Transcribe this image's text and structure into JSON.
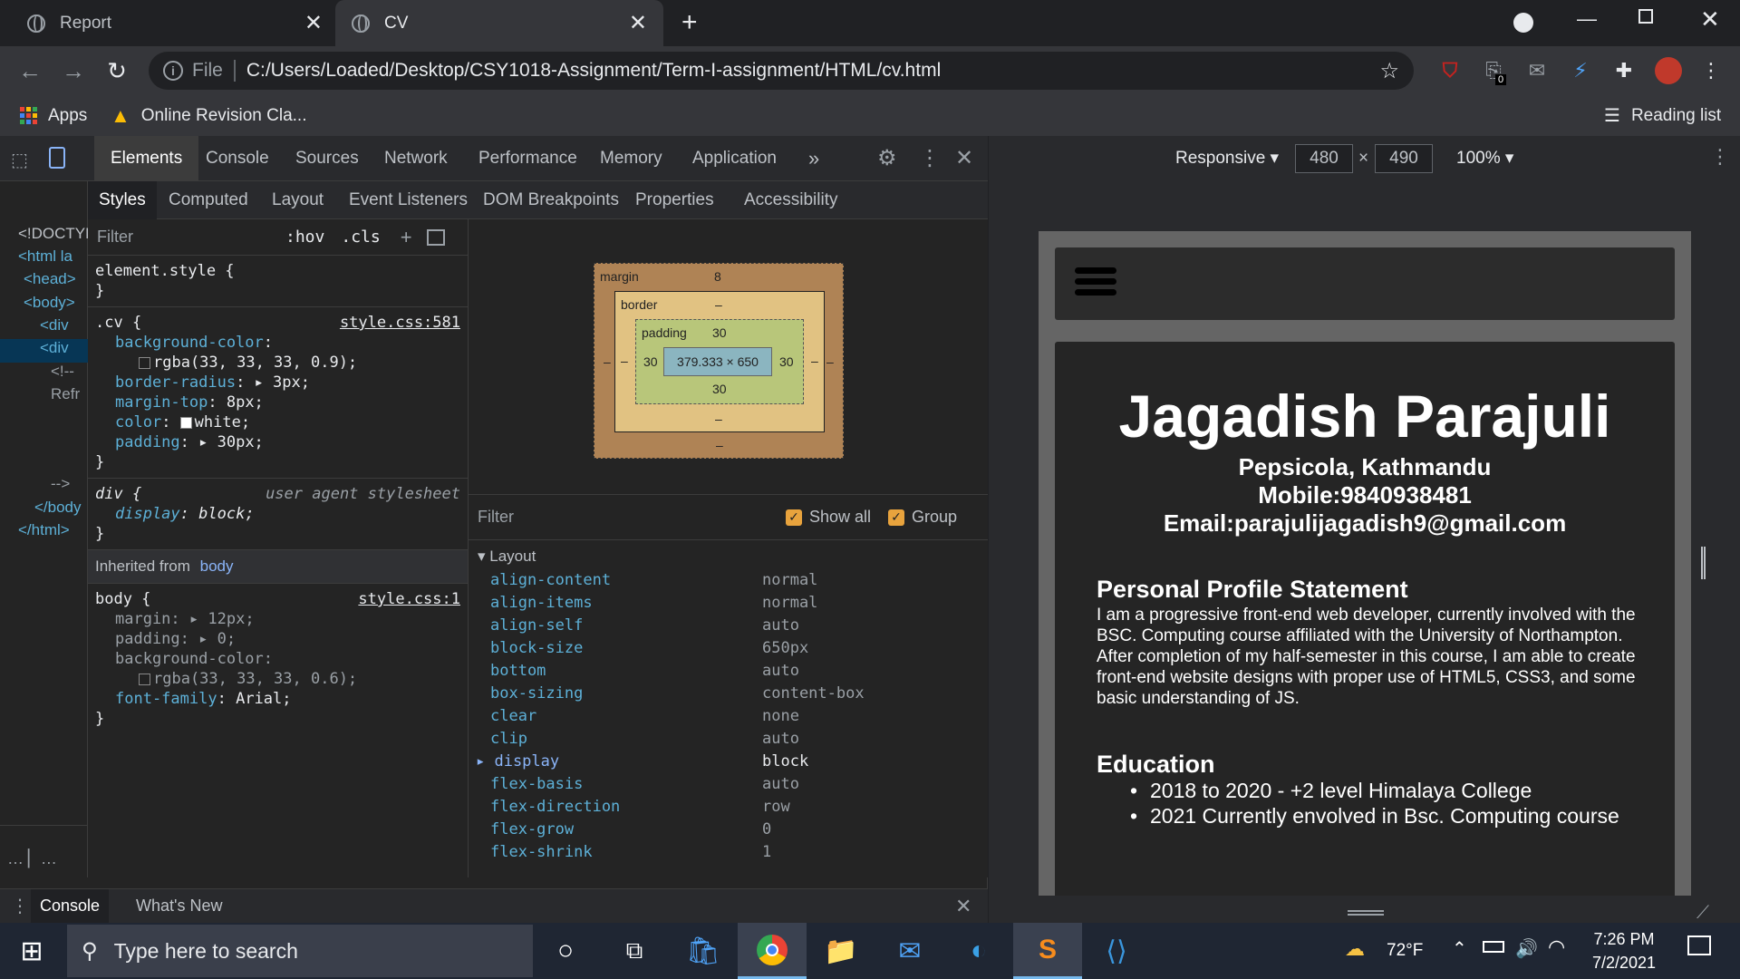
{
  "browser": {
    "tabs": [
      {
        "title": "Report",
        "close": "✕"
      },
      {
        "title": "CV",
        "close": "✕"
      }
    ],
    "new_tab": "+",
    "url_scheme": "File",
    "url": "C:/Users/Loaded/Desktop/CSY1018-Assignment/Term-I-assignment/HTML/cv.html",
    "ext_badge": "0",
    "bookmarks": {
      "apps": "Apps",
      "item": "Online Revision Cla...",
      "reading_list": "Reading list"
    }
  },
  "devtools": {
    "tabs": [
      "Elements",
      "Console",
      "Sources",
      "Network",
      "Performance",
      "Memory",
      "Application"
    ],
    "more": "»",
    "subtabs": [
      "Styles",
      "Computed",
      "Layout",
      "Event Listeners",
      "DOM Breakpoints",
      "Properties",
      "Accessibility"
    ],
    "dom": [
      "<!DOCTYP",
      "<html la",
      "<head>",
      "<body>",
      "<div",
      "<div",
      "<!--",
      "Refr",
      "-->",
      "</body",
      "</html>"
    ],
    "styles_filter": "Filter",
    "hov": ":hov",
    "cls": ".cls",
    "element_style": "element.style {",
    "cv_rule": {
      "selector": ".cv {",
      "source": "style.css:581",
      "props": [
        {
          "k": "background-color",
          "v": "rgba(33, 33, 33, 0.9);"
        },
        {
          "k": "border-radius",
          "v": "3px;"
        },
        {
          "k": "margin-top",
          "v": "8px;"
        },
        {
          "k": "color",
          "v": "white;"
        },
        {
          "k": "padding",
          "v": "30px;"
        }
      ]
    },
    "div_rule": {
      "selector": "div {",
      "source": "user agent stylesheet",
      "prop": "display",
      "val": "block;"
    },
    "inherited": {
      "label": "Inherited from",
      "from": "body"
    },
    "body_rule": {
      "selector": "body {",
      "source": "style.css:1",
      "props": [
        {
          "k": "margin",
          "v": "12px;"
        },
        {
          "k": "padding",
          "v": "0;"
        },
        {
          "k": "background-color",
          "v": "rgba(33, 33, 33, 0.6);"
        },
        {
          "k": "font-family",
          "v": "Arial;"
        }
      ]
    },
    "boxmodel": {
      "margin": "margin",
      "margin_val": "8",
      "border": "border",
      "border_val": "–",
      "padding": "padding",
      "padding_val": "30",
      "content": "379.333 × 650",
      "dash": "–"
    },
    "computed_filter": "Filter",
    "show_all": "Show all",
    "group": "Group",
    "layout_group": "Layout",
    "computed": [
      {
        "k": "align-content",
        "v": "normal"
      },
      {
        "k": "align-items",
        "v": "normal"
      },
      {
        "k": "align-self",
        "v": "auto"
      },
      {
        "k": "block-size",
        "v": "650px"
      },
      {
        "k": "bottom",
        "v": "auto"
      },
      {
        "k": "box-sizing",
        "v": "content-box"
      },
      {
        "k": "clear",
        "v": "none"
      },
      {
        "k": "clip",
        "v": "auto"
      },
      {
        "k": "display",
        "v": "block"
      },
      {
        "k": "flex-basis",
        "v": "auto"
      },
      {
        "k": "flex-direction",
        "v": "row"
      },
      {
        "k": "flex-grow",
        "v": "0"
      },
      {
        "k": "flex-shrink",
        "v": "1"
      }
    ],
    "drawer_tabs": [
      "Console",
      "What's New"
    ]
  },
  "device": {
    "mode": "Responsive",
    "width": "480",
    "height": "490",
    "zoom": "100%",
    "times": "×"
  },
  "cv": {
    "name": "Jagadish Parajuli",
    "address": "Pepsicola, Kathmandu",
    "mobile": "Mobile:9840938481",
    "email": "Email:parajulijagadish9@gmail.com",
    "profile_heading": "Personal Profile Statement",
    "profile_text": "I am a progressive front-end web developer, currently involved with the BSC. Computing course affiliated with the University of Northampton. After completion of my half-semester in this course, I am able to create front-end website designs with proper use of HTML5, CSS3, and some basic understanding of JS.",
    "education_heading": "Education",
    "education": [
      "2018 to 2020 - +2 level Himalaya College",
      "2021 Currently envolved in Bsc. Computing course"
    ]
  },
  "taskbar": {
    "search": "Type here to search",
    "weather": "72°F",
    "time": "7:26 PM",
    "date": "7/2/2021"
  },
  "colors": {
    "accent": "#8ab4f8",
    "checkbox": "#e8a33d"
  }
}
